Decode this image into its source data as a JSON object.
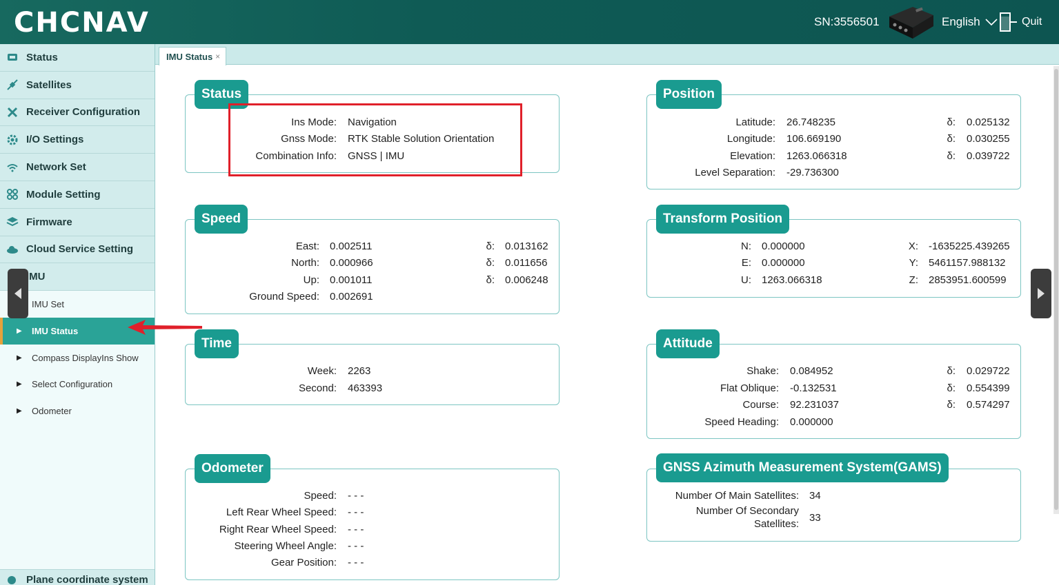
{
  "header": {
    "logo": "CHCNAV",
    "sn": "SN:3556501",
    "language": "English",
    "quit": "Quit"
  },
  "sidebar": {
    "items": [
      {
        "label": "Status",
        "icon": "status-icon"
      },
      {
        "label": "Satellites",
        "icon": "satellite-icon"
      },
      {
        "label": "Receiver Configuration",
        "icon": "tools-icon"
      },
      {
        "label": "I/O Settings",
        "icon": "gear-icon"
      },
      {
        "label": "Network Set",
        "icon": "wifi-icon"
      },
      {
        "label": "Module Setting",
        "icon": "modules-icon"
      },
      {
        "label": "Firmware",
        "icon": "layers-icon"
      },
      {
        "label": "Cloud Service Setting",
        "icon": "cloud-icon"
      },
      {
        "label": "IMU",
        "icon": "imu-icon"
      }
    ],
    "subitems": [
      {
        "label": "IMU Set"
      },
      {
        "label": "IMU Status"
      },
      {
        "label": "Compass DisplayIns Show"
      },
      {
        "label": "Select Configuration"
      },
      {
        "label": "Odometer"
      }
    ],
    "bottom": "Plane coordinate system"
  },
  "tab": {
    "label": "IMU Status",
    "close": "×"
  },
  "status": {
    "title": "Status",
    "ins_mode_label": "Ins Mode:",
    "ins_mode": "Navigation",
    "gnss_mode_label": "Gnss Mode:",
    "gnss_mode": "RTK Stable Solution Orientation",
    "combination_label": "Combination Info:",
    "combination": "GNSS | IMU"
  },
  "position": {
    "title": "Position",
    "rows": [
      {
        "label": "Latitude:",
        "value": "26.748235",
        "delta_label": "δ:",
        "delta": "0.025132"
      },
      {
        "label": "Longitude:",
        "value": "106.669190",
        "delta_label": "δ:",
        "delta": "0.030255"
      },
      {
        "label": "Elevation:",
        "value": "1263.066318",
        "delta_label": "δ:",
        "delta": "0.039722"
      },
      {
        "label": "Level Separation:",
        "value": "-29.736300"
      }
    ]
  },
  "speed": {
    "title": "Speed",
    "rows": [
      {
        "label": "East:",
        "value": "0.002511",
        "delta_label": "δ:",
        "delta": "0.013162"
      },
      {
        "label": "North:",
        "value": "0.000966",
        "delta_label": "δ:",
        "delta": "0.011656"
      },
      {
        "label": "Up:",
        "value": "0.001011",
        "delta_label": "δ:",
        "delta": "0.006248"
      },
      {
        "label": "Ground Speed:",
        "value": "0.002691"
      }
    ]
  },
  "transform": {
    "title": "Transform Position",
    "rows": [
      {
        "label": "N:",
        "value": "0.000000",
        "label2": "X:",
        "value2": "-1635225.439265"
      },
      {
        "label": "E:",
        "value": "0.000000",
        "label2": "Y:",
        "value2": "5461157.988132"
      },
      {
        "label": "U:",
        "value": "1263.066318",
        "label2": "Z:",
        "value2": "2853951.600599"
      }
    ]
  },
  "time": {
    "title": "Time",
    "week_label": "Week:",
    "week": "2263",
    "second_label": "Second:",
    "second": "463393"
  },
  "attitude": {
    "title": "Attitude",
    "rows": [
      {
        "label": "Shake:",
        "value": "0.084952",
        "delta_label": "δ:",
        "delta": "0.029722"
      },
      {
        "label": "Flat Oblique:",
        "value": "-0.132531",
        "delta_label": "δ:",
        "delta": "0.554399"
      },
      {
        "label": "Course:",
        "value": "92.231037",
        "delta_label": "δ:",
        "delta": "0.574297"
      },
      {
        "label": "Speed Heading:",
        "value": "0.000000"
      }
    ]
  },
  "odometer": {
    "title": "Odometer",
    "rows": [
      {
        "label": "Speed:",
        "value": "- - -"
      },
      {
        "label": "Left Rear Wheel Speed:",
        "value": "- - -"
      },
      {
        "label": "Right Rear Wheel Speed:",
        "value": "- - -"
      },
      {
        "label": "Steering Wheel Angle:",
        "value": "- - -"
      },
      {
        "label": "Gear Position:",
        "value": "- - -"
      }
    ]
  },
  "gams": {
    "title": "GNSS Azimuth Measurement System(GAMS)",
    "main_label": "Number Of Main Satellites:",
    "main": "34",
    "secondary_label_1": "Number Of Secondary",
    "secondary_label_2": "Satellites:",
    "secondary": "33"
  },
  "colors": {
    "header": "#0f5b55",
    "accent": "#1a9b90",
    "highlight": "#e0202a"
  }
}
